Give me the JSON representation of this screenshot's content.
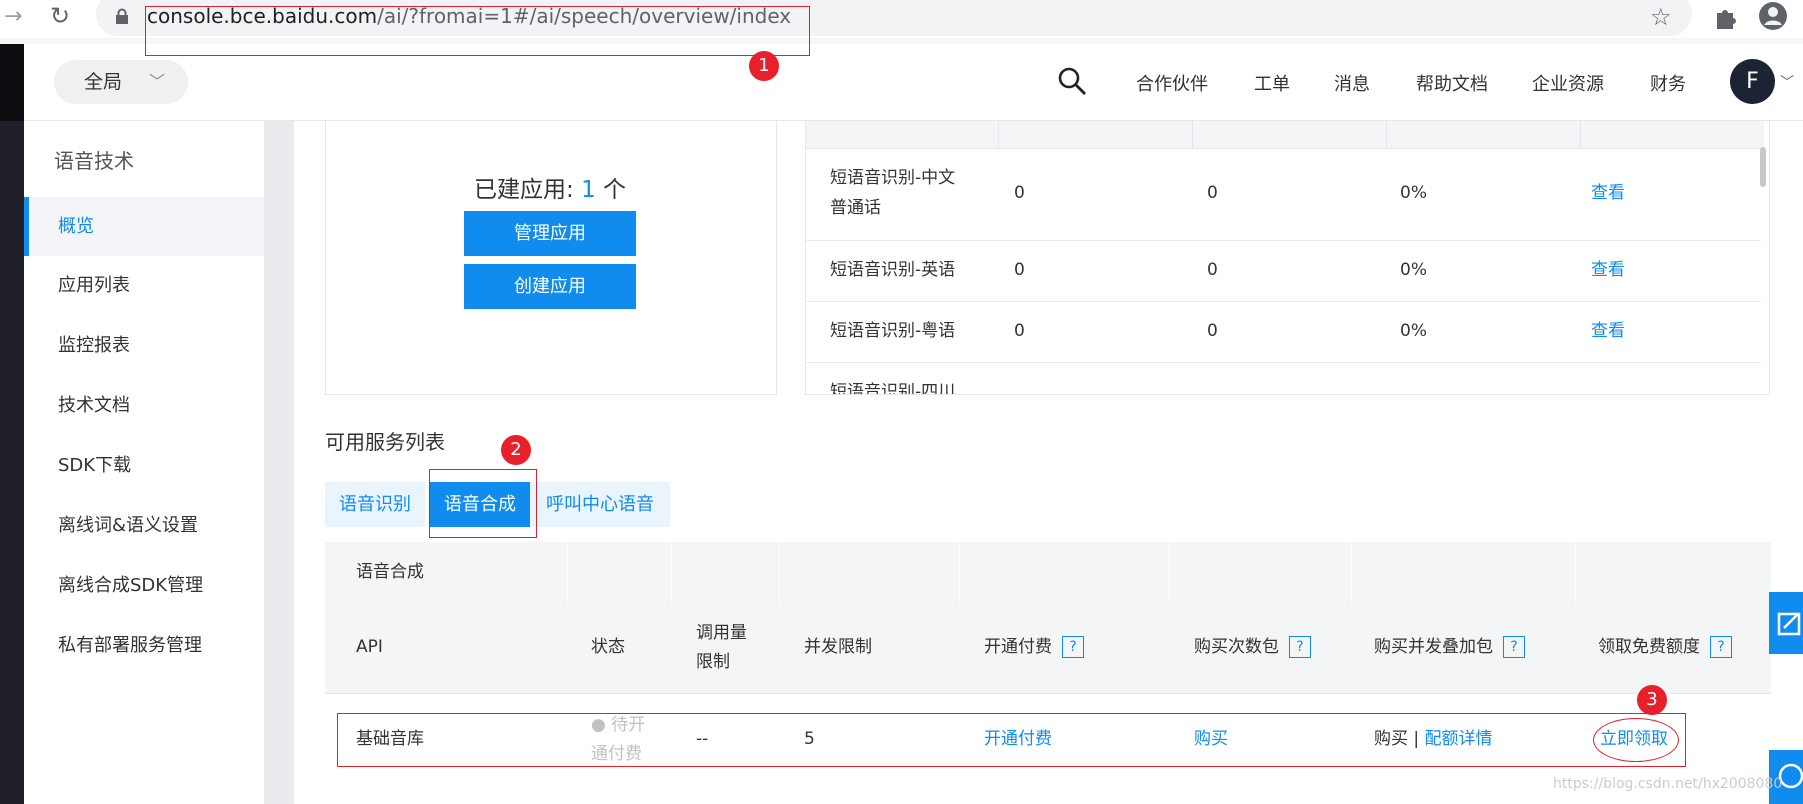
{
  "browser": {
    "url_host": "console.bce.baidu.com",
    "url_rest": "/ai/?fromai=1#/ai/speech/overview/index"
  },
  "header": {
    "scope": "全局",
    "nav": [
      "合作伙伴",
      "工单",
      "消息",
      "帮助文档",
      "企业资源",
      "财务"
    ],
    "avatar_letter": "F"
  },
  "sidebar": {
    "title": "语音技术",
    "items": [
      "概览",
      "应用列表",
      "监控报表",
      "技术文档",
      "SDK下载",
      "离线词&语义设置",
      "离线合成SDK管理",
      "私有部署服务管理"
    ],
    "active_index": 0
  },
  "app_card": {
    "label": "已建应用:",
    "count": "1",
    "unit": "个",
    "manage_label": "管理应用",
    "create_label": "创建应用"
  },
  "stats_rows": [
    {
      "api": [
        "短语音识别-中文",
        "普通话"
      ],
      "v1": "0",
      "v2": "0",
      "v3": "0%",
      "action": "查看"
    },
    {
      "api": [
        "短语音识别-英语"
      ],
      "v1": "0",
      "v2": "0",
      "v3": "0%",
      "action": "查看"
    },
    {
      "api": [
        "短语音识别-粤语"
      ],
      "v1": "0",
      "v2": "0",
      "v3": "0%",
      "action": "查看"
    },
    {
      "api": [
        "短语音识别-四川"
      ],
      "v1": "",
      "v2": "",
      "v3": "",
      "action": ""
    }
  ],
  "services": {
    "title": "可用服务列表",
    "tabs": [
      "语音识别",
      "语音合成",
      "呼叫中心语音"
    ],
    "active_tab": 1,
    "category": "语音合成",
    "headers": {
      "api": "API",
      "status": "状态",
      "limit_line1": "调用量",
      "limit_line2": "限制",
      "concurrency": "并发限制",
      "pay": "开通付费",
      "buy_count": "购买次数包",
      "buy_concurrency": "购买并发叠加包",
      "free_quota": "领取免费额度",
      "help": "?"
    },
    "row": {
      "api": "基础音库",
      "status_line1": "● 待开",
      "status_line2": "通付费",
      "limit": "--",
      "concurrency": "5",
      "pay": "开通付费",
      "buy_count": "购买",
      "buy_concurrency_buy": "购买",
      "separator": "|",
      "quota_detail": "配额详情",
      "free_quota": "立即领取"
    }
  },
  "annotations": [
    "1",
    "2",
    "3"
  ],
  "watermark": "https://blog.csdn.net/hx2008080",
  "colors": {
    "accent": "#108cee",
    "annotation": "#e0202a"
  }
}
